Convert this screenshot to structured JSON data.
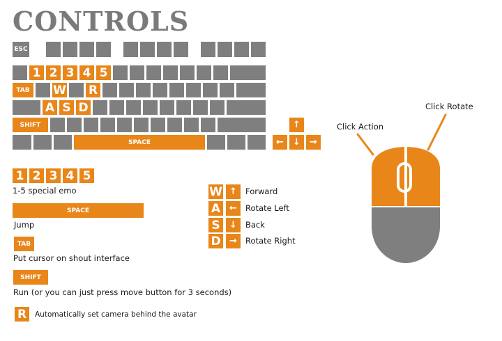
{
  "title": "CONTROLS",
  "keys": {
    "esc": "ESC",
    "n1": "1",
    "n2": "2",
    "n3": "3",
    "n4": "4",
    "n5": "5",
    "tab": "TAB",
    "w": "W",
    "r": "R",
    "a": "A",
    "s": "S",
    "d": "D",
    "shift": "SHIFT",
    "space": "SPACE",
    "arrow_up": "↑",
    "arrow_left": "←",
    "arrow_down": "↓",
    "arrow_right": "→"
  },
  "legend": {
    "emo_label": "1-5 special emo",
    "jump_label": "Jump",
    "tab_label": "Put cursor on shout interface",
    "shift_label": "Run (or you can just press move button for 3 seconds)",
    "r_label": "Automatically set camera behind the avatar"
  },
  "movement": {
    "forward": "Forward",
    "rotate_left": "Rotate Left",
    "back": "Back",
    "rotate_right": "Rotate Right"
  },
  "mouse": {
    "left_label": "Click Action",
    "right_label": "Click Rotate"
  },
  "colors": {
    "accent": "#e8861a",
    "key_gray": "#7f7f7f",
    "title_gray": "#7a7a7a"
  }
}
